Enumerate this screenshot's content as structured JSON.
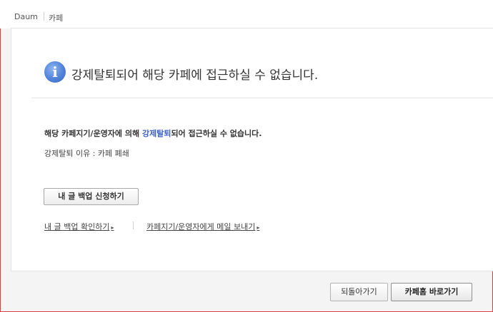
{
  "header": {
    "brand": "Daum",
    "section": "카페"
  },
  "notice": {
    "icon": "info-icon",
    "title": "강제탈퇴되어 해당 카페에 접근하실 수 없습니다.",
    "desc_prefix": "해당 카페지기/운영자에 의해 ",
    "desc_highlight": "강제탈퇴",
    "desc_suffix": "되어 접근하실 수 없습니다.",
    "reason": "강제탈퇴 이유 : 카페 폐쇄"
  },
  "actions": {
    "backup_request": "내 글 백업 신청하기",
    "backup_check_link": "내 글 백업 확인하기",
    "mail_link": "카페지기/운영자에게 메일 보내기",
    "link_arrow": "▸",
    "go_back": "되돌아가기",
    "cafe_home": "카페홈 바로가기"
  },
  "colors": {
    "highlight": "#3b62c4",
    "border_frame": "#e23b3b",
    "icon": "#4f82d8"
  }
}
